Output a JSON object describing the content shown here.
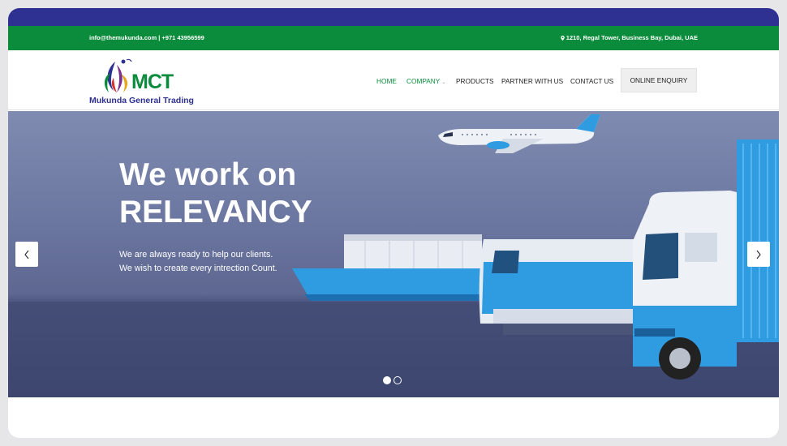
{
  "topbar": {
    "email_phone": "info@themukunda.com | +971 43956599",
    "address": "1210, Regal Tower, Business Bay, Dubai, UAE"
  },
  "brand": {
    "logo_letters": "MCT",
    "name": "Mukunda General Trading",
    "colors": {
      "blue": "#2e3192",
      "green": "#0b8c3c"
    }
  },
  "nav": {
    "items": [
      {
        "label": "HOME",
        "active": true
      },
      {
        "label": "COMPANY",
        "active": false,
        "has_dropdown": true
      },
      {
        "label": "PRODUCTS",
        "active": false
      },
      {
        "label": "PARTNER WITH US",
        "active": false
      },
      {
        "label": "CONTACT US",
        "active": false
      }
    ],
    "enquiry_label": "ONLINE ENQUIRY"
  },
  "hero": {
    "title_line1": "We work on",
    "title_line2": "RELEVANCY",
    "sub_line1": "We are always ready to help our clients.",
    "sub_line2": "We wish to create every intrection Count.",
    "slides_total": 2,
    "current_slide": 1,
    "prev_icon": "chevron-left-icon",
    "next_icon": "chevron-right-icon"
  }
}
